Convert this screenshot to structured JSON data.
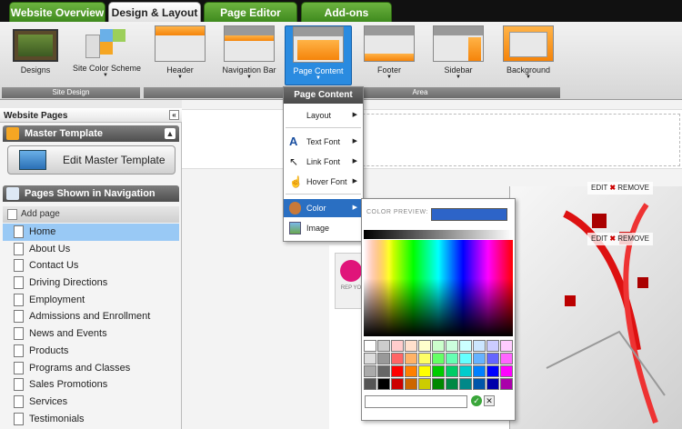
{
  "tabs": [
    {
      "label": "Website Overview",
      "active": false
    },
    {
      "label": "Design & Layout",
      "active": true
    },
    {
      "label": "Page Editor",
      "active": false
    },
    {
      "label": "Add-ons",
      "active": false
    }
  ],
  "ribbon": {
    "buttons": [
      {
        "label": "Designs",
        "icon": "designs-icon"
      },
      {
        "label": "Site Color Scheme",
        "icon": "color-scheme-icon"
      },
      {
        "label": "Header",
        "icon": "header-layout-icon"
      },
      {
        "label": "Navigation Bar",
        "icon": "navbar-layout-icon"
      },
      {
        "label": "Page Content",
        "icon": "page-content-layout-icon",
        "selected": true
      },
      {
        "label": "Footer",
        "icon": "footer-layout-icon"
      },
      {
        "label": "Sidebar",
        "icon": "sidebar-layout-icon"
      },
      {
        "label": "Background",
        "icon": "background-layout-icon"
      }
    ],
    "groups": {
      "site_design": "Site Design",
      "area": "Area"
    }
  },
  "left_panel": {
    "title": "Website Pages",
    "master_template": {
      "header": "Master Template",
      "button": "Edit Master Template"
    },
    "navigation": {
      "header": "Pages Shown in Navigation",
      "add_page": "Add page"
    },
    "pages": [
      "Home",
      "About Us",
      "Contact Us",
      "Driving Directions",
      "Employment",
      "Admissions and Enrollment",
      "News and Events",
      "Products",
      "Programs and Classes",
      "Sales Promotions",
      "Services",
      "Testimonials"
    ],
    "selected_page": "Home"
  },
  "canvas": {
    "edit_label": "EDIT",
    "remove_label": "REMOVE",
    "promo_text": "REP YO"
  },
  "menu": {
    "title": "Page Content",
    "items": [
      {
        "label": "Layout",
        "submenu": true
      },
      {
        "label": "Text Font",
        "submenu": true,
        "icon": "text-font-icon"
      },
      {
        "label": "Link Font",
        "submenu": true,
        "icon": "cursor-icon"
      },
      {
        "label": "Hover Font",
        "submenu": true,
        "icon": "hand-pointer-icon"
      },
      {
        "label": "Color",
        "submenu": true,
        "icon": "palette-icon",
        "selected": true
      },
      {
        "label": "Image",
        "submenu": false,
        "icon": "image-icon"
      }
    ]
  },
  "color_picker": {
    "preview_label": "COLOR PREVIEW:",
    "preview_color": "#2d64c8",
    "hex_value": "",
    "swatches": [
      "#ffffff",
      "#cccccc",
      "#ffcccc",
      "#ffe0cc",
      "#ffffcc",
      "#ccffcc",
      "#ccffdd",
      "#ccffff",
      "#cce6ff",
      "#ccccff",
      "#ffccff",
      "#dddddd",
      "#999999",
      "#ff6666",
      "#ffb366",
      "#ffff66",
      "#66ff66",
      "#66ffb3",
      "#66ffff",
      "#66b3ff",
      "#6666ff",
      "#ff66ff",
      "#aaaaaa",
      "#666666",
      "#ff0000",
      "#ff8000",
      "#ffff00",
      "#00cc00",
      "#00cc66",
      "#00cccc",
      "#0080ff",
      "#0000ff",
      "#ff00ff",
      "#555555",
      "#000000",
      "#cc0000",
      "#cc6600",
      "#cccc00",
      "#008800",
      "#008844",
      "#008888",
      "#0055aa",
      "#0000aa",
      "#aa00aa"
    ]
  }
}
